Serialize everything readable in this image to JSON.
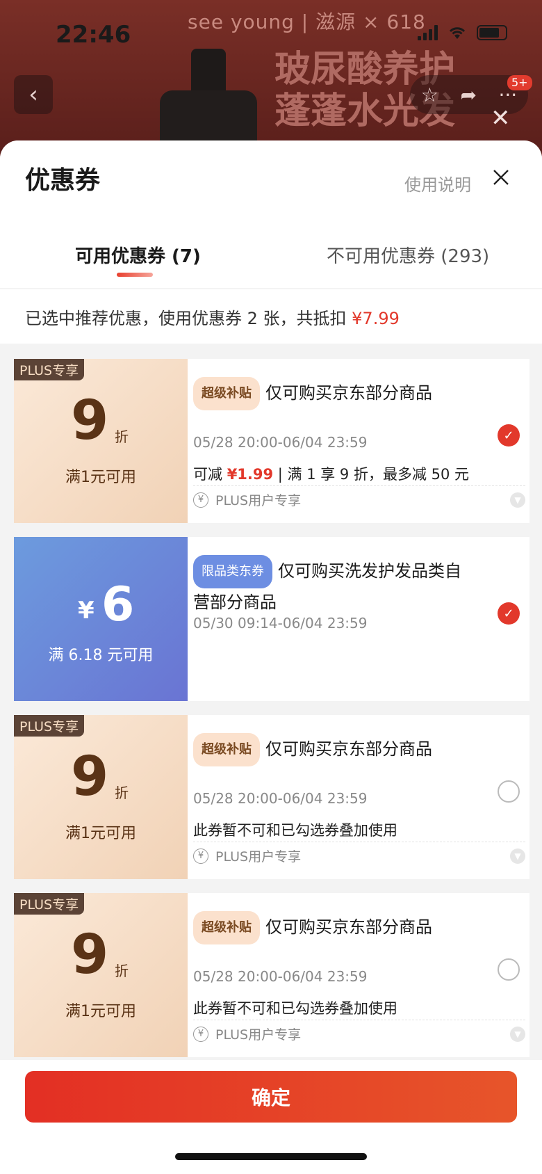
{
  "status_bar": {
    "time": "22:46"
  },
  "background": {
    "brand": "see young | 滋源 × 618",
    "headline_line1": "玻尿酸养护",
    "headline_line2": "蓬蓬水光发",
    "cart_badge": "5+"
  },
  "sheet": {
    "title": "优惠券",
    "help_link": "使用说明",
    "tabs": [
      {
        "label": "可用优惠券 (7)",
        "active": true
      },
      {
        "label": "不可用优惠券 (293)",
        "active": false
      }
    ],
    "summary_prefix": "已选中推荐优惠，使用优惠券 2 张，共抵扣 ",
    "summary_amount": "¥7.99"
  },
  "coupons": [
    {
      "type": "plus",
      "plus_tag": "PLUS专享",
      "discount": "9",
      "unit": "折",
      "condition": "满1元可用",
      "tag": "超级补贴",
      "title": "仅可购买京东部分商品",
      "date": "05/28 20:00-06/04 23:59",
      "line_a": "可减 ",
      "line_red": "¥1.99",
      "line_b": "  |  满 1 享 9 折，最多减 50 元",
      "footer": "PLUS用户专享",
      "checked": true
    },
    {
      "type": "blue",
      "yen": "¥",
      "amount": "6",
      "condition": "满 6.18 元可用",
      "tag": "限品类东券",
      "title": "仅可购买洗发护发品类自营部分商品",
      "date": "05/30 09:14-06/04 23:59",
      "checked": true
    },
    {
      "type": "plus",
      "plus_tag": "PLUS专享",
      "discount": "9",
      "unit": "折",
      "condition": "满1元可用",
      "tag": "超级补贴",
      "title": "仅可购买京东部分商品",
      "date": "05/28 20:00-06/04 23:59",
      "note": "此券暂不可和已勾选券叠加使用",
      "footer": "PLUS用户专享",
      "checked": false
    },
    {
      "type": "plus",
      "plus_tag": "PLUS专享",
      "discount": "9",
      "unit": "折",
      "condition": "满1元可用",
      "tag": "超级补贴",
      "title": "仅可购买京东部分商品",
      "date": "05/28 20:00-06/04 23:59",
      "note": "此券暂不可和已勾选券叠加使用",
      "footer": "PLUS用户专享",
      "checked": false
    }
  ],
  "confirm_label": "确定",
  "icons": {
    "back": "chevron-left-icon",
    "favorite": "star-icon",
    "share": "share-icon",
    "more": "more-icon",
    "close": "close-icon",
    "check": "check-icon",
    "yen": "yen-circle-icon",
    "expand": "chevron-down-icon"
  },
  "colors": {
    "accent_red": "#e2382b",
    "plus_brown": "#5a3316",
    "blue_coupon": "#6a74d3"
  }
}
